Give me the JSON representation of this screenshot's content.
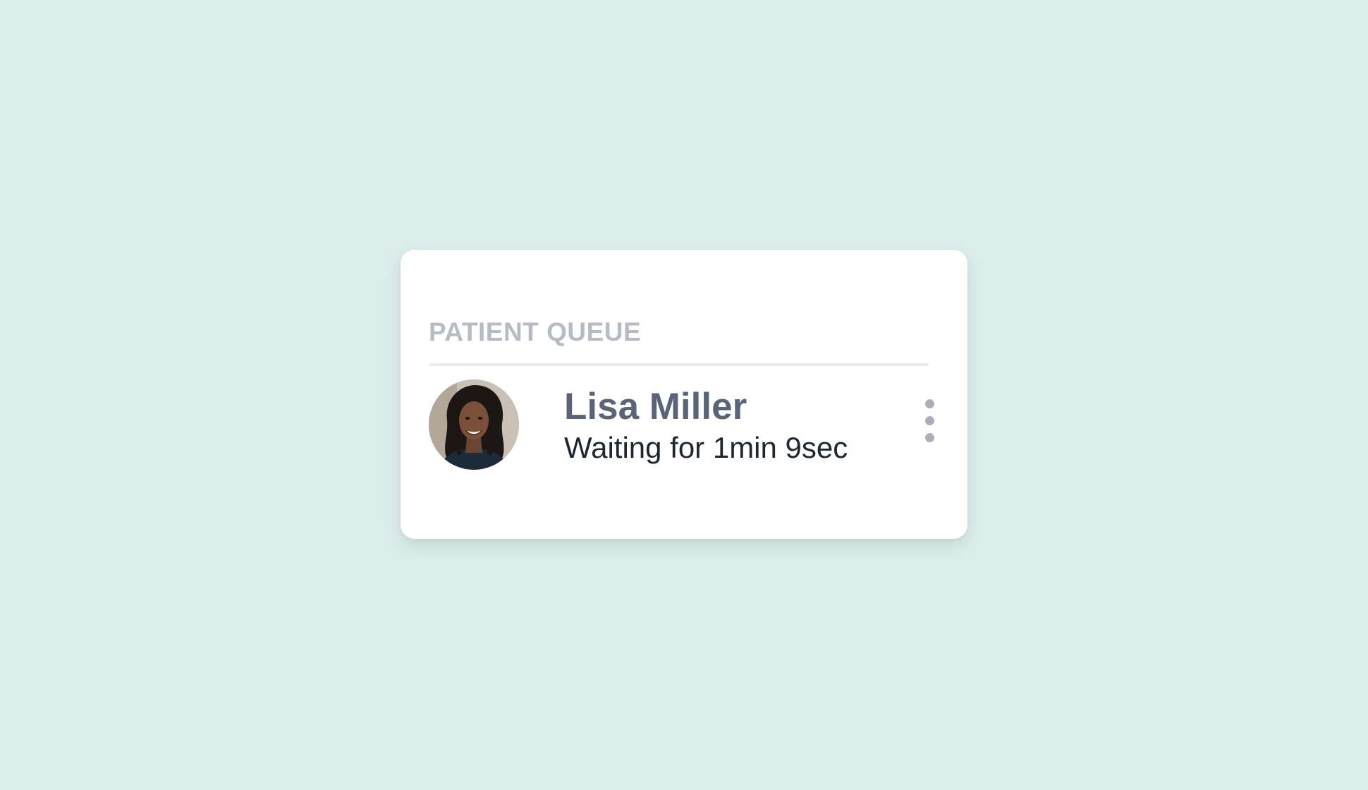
{
  "card": {
    "title": "PATIENT QUEUE"
  },
  "queue": [
    {
      "name": "Lisa Miller",
      "status": "Waiting for 1min 9sec",
      "avatar_alt": "Lisa Miller"
    }
  ],
  "icons": {
    "more": "more-vertical-icon"
  },
  "colors": {
    "background": "#ddedeb",
    "card": "#ffffff",
    "title": "#b7bbc6",
    "name": "#5a6478",
    "status": "#1f2630",
    "dots": "#aab0bb"
  }
}
